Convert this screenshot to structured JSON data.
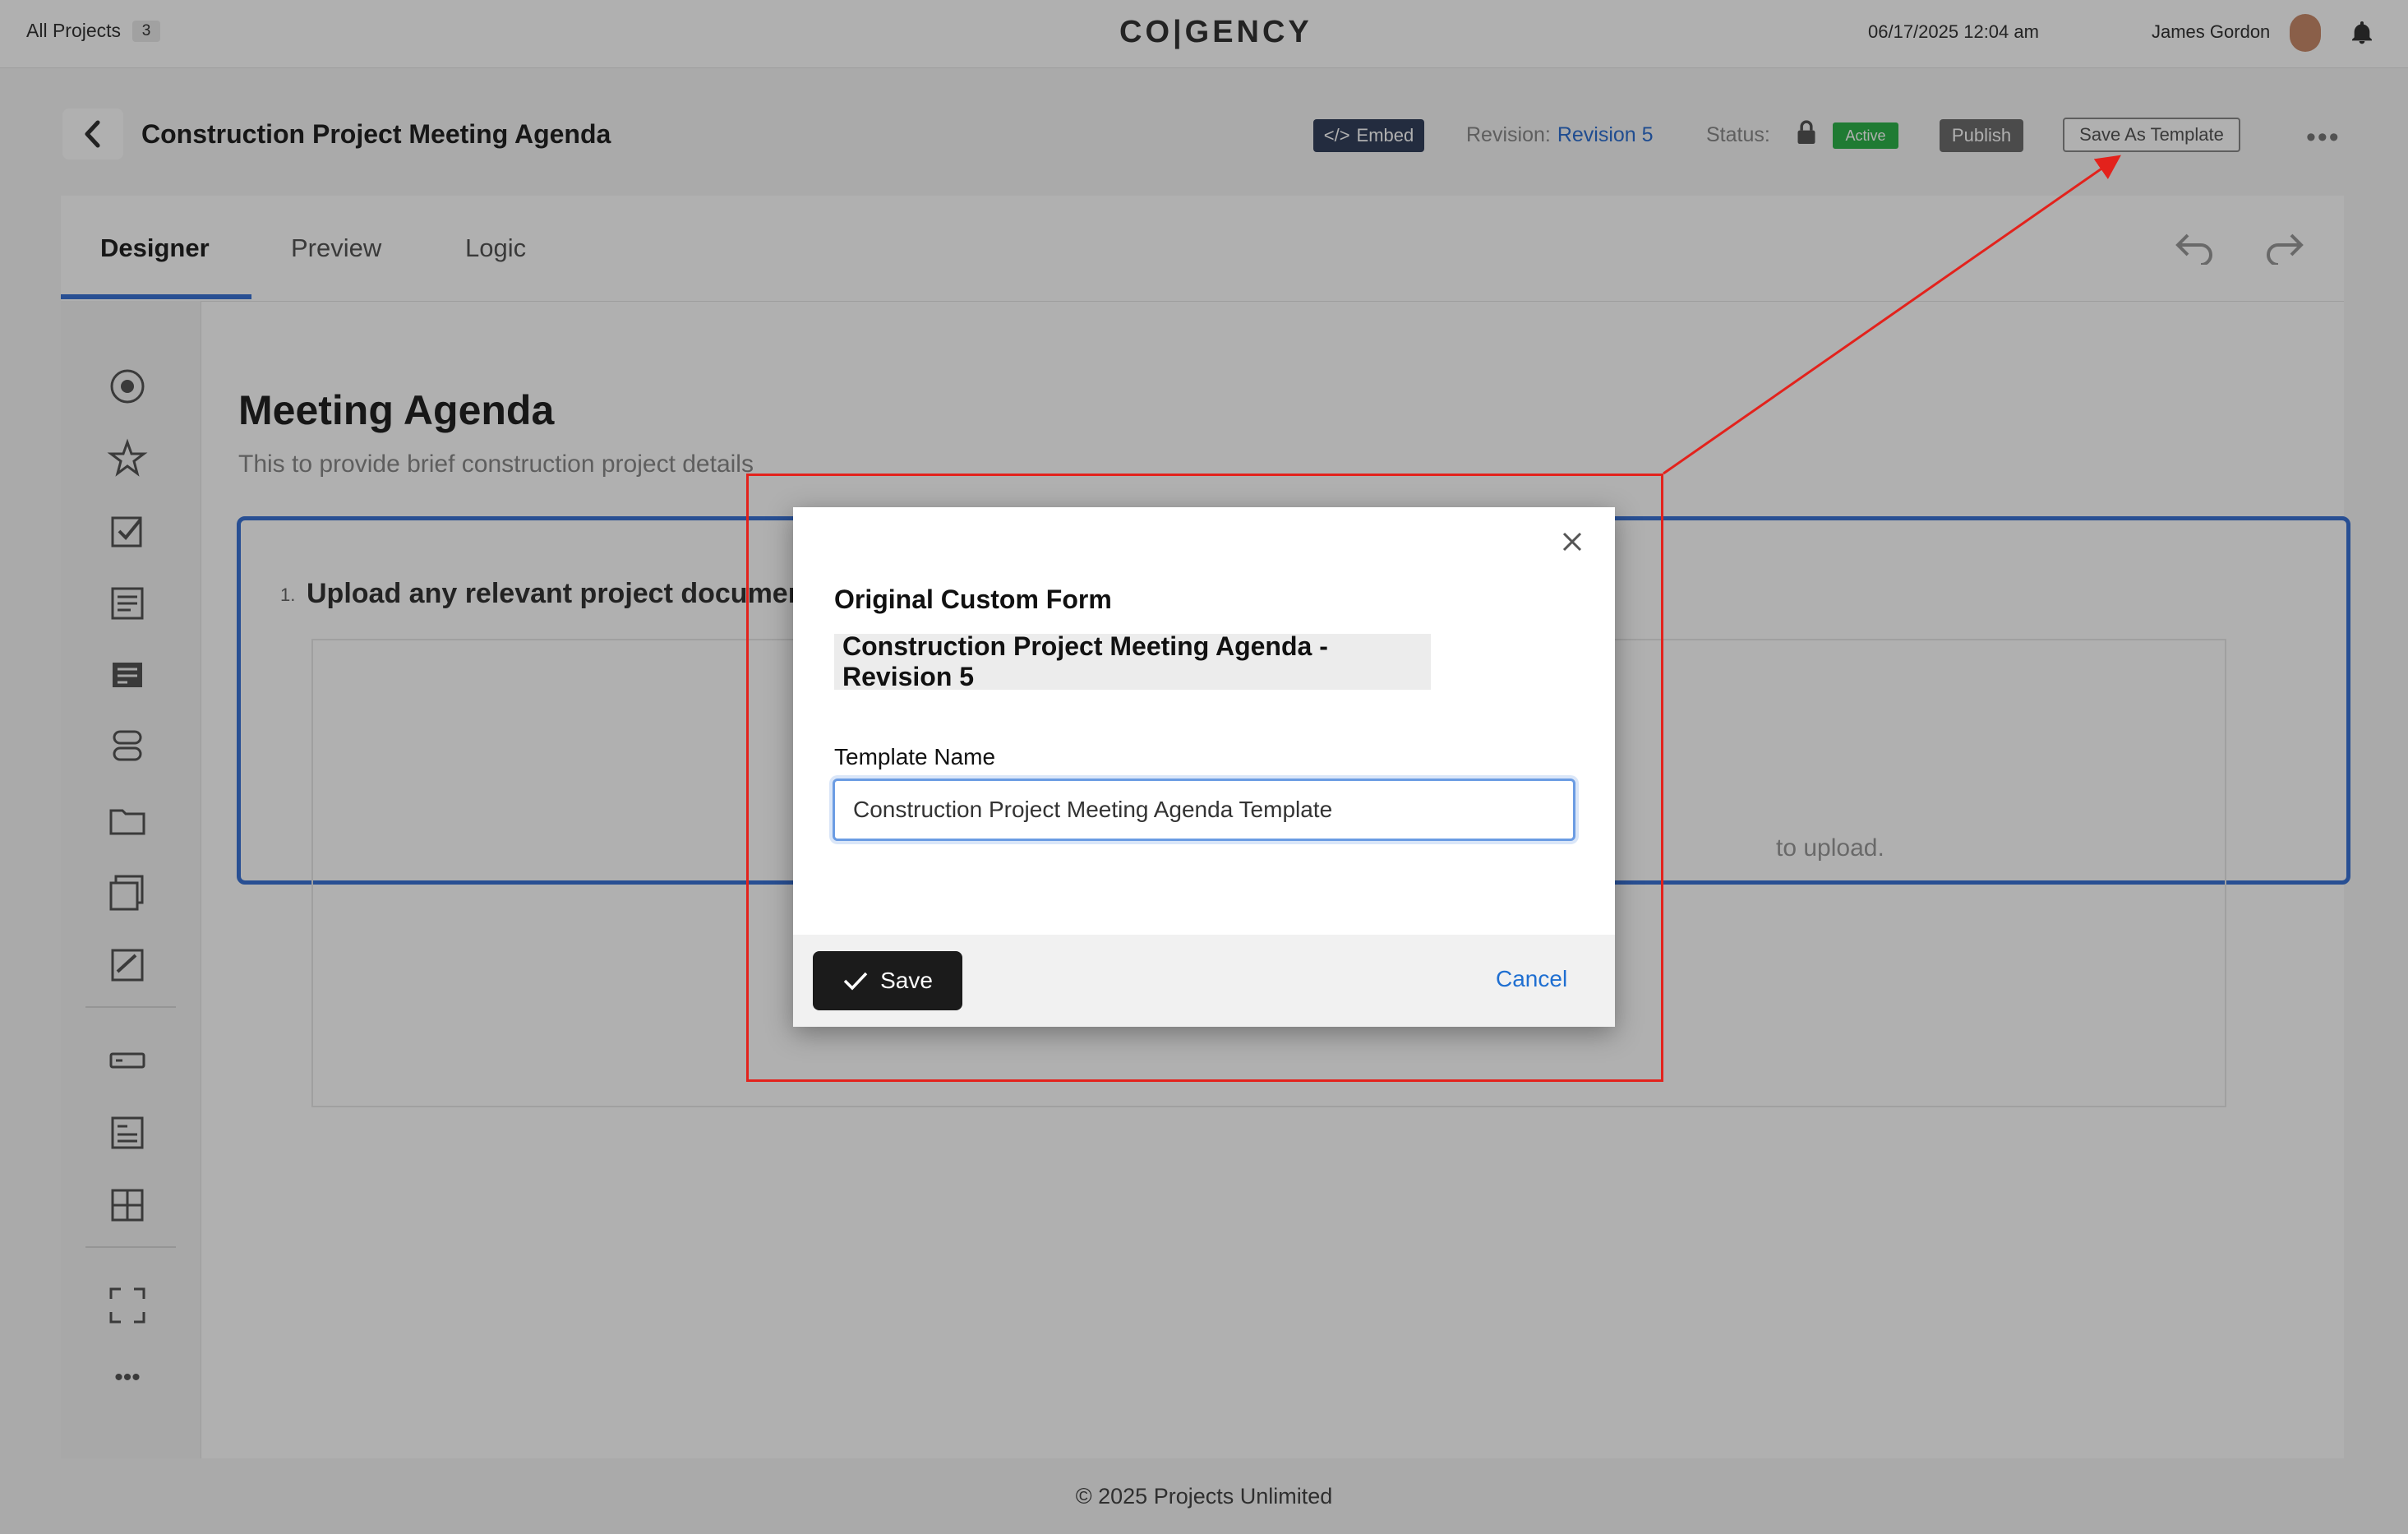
{
  "topbar": {
    "projects_label": "All Projects",
    "projects_count": "3",
    "logo": "CO|GENCY",
    "datetime": "06/17/2025 12:04 am",
    "user_name": "James Gordon"
  },
  "header": {
    "page_title": "Construction Project Meeting Agenda",
    "embed_label": "Embed",
    "revision_label": "Revision:",
    "revision_value": "Revision 5",
    "status_label": "Status:",
    "status_value": "Active",
    "publish_label": "Publish",
    "save_template_label": "Save As Template"
  },
  "tabs": [
    {
      "label": "Designer",
      "active": true
    },
    {
      "label": "Preview",
      "active": false
    },
    {
      "label": "Logic",
      "active": false
    }
  ],
  "form": {
    "title": "Meeting Agenda",
    "subtitle": "This to provide brief construction project details",
    "question_number": "1.",
    "question_text": "Upload any relevant project documents",
    "drop_text": "to upload."
  },
  "footer": {
    "copyright": "© 2025 Projects Unlimited"
  },
  "modal": {
    "heading": "Original Custom Form",
    "original_form_name": "Construction Project Meeting Agenda - Revision 5",
    "field_label": "Template Name",
    "template_name_value": "Construction Project Meeting Agenda Template",
    "save_label": "Save",
    "cancel_label": "Cancel"
  },
  "colors": {
    "accent_blue": "#3a73d6",
    "status_green": "#2eb24a",
    "annotation_red": "#e3221c",
    "link_blue": "#1f6fd1"
  }
}
